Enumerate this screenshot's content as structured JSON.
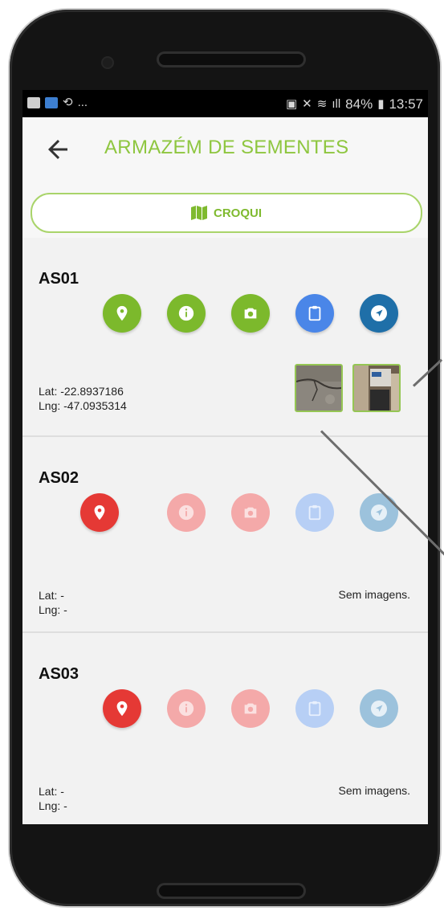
{
  "status_bar": {
    "left_icons": [
      "image-icon",
      "app-icon",
      "sync-icon"
    ],
    "left_ellipsis": "...",
    "battery_percent": "84%",
    "time": "13:57"
  },
  "app_bar": {
    "title": "ARMAZÉM DE SEMENTES",
    "back_icon": "arrow-left-icon"
  },
  "croqui_button": {
    "label": "CROQUI",
    "icon": "map-icon"
  },
  "colors": {
    "accent_green": "#8ec63f",
    "green_button": "#7cb92c",
    "blue_button": "#4a86e8",
    "navy_button": "#1f6fa8",
    "red_button": "#e53935",
    "faded_red": "#f4a9a9",
    "faded_blue": "#b7cff5",
    "faded_navy": "#9cc2dc"
  },
  "items": [
    {
      "id": "AS01",
      "lat_label": "Lat: -22.8937186",
      "lng_label": "Lng: -47.0935314",
      "images_text": "",
      "has_images": true,
      "image_count": 2,
      "state": "active"
    },
    {
      "id": "AS02",
      "lat_label": "Lat: -",
      "lng_label": "Lng: -",
      "images_text": "Sem imagens.",
      "has_images": false,
      "image_count": 0,
      "state": "pending"
    },
    {
      "id": "AS03",
      "lat_label": "Lat: -",
      "lng_label": "Lng: -",
      "images_text": "Sem imagens.",
      "has_images": false,
      "image_count": 0,
      "state": "pending"
    }
  ]
}
